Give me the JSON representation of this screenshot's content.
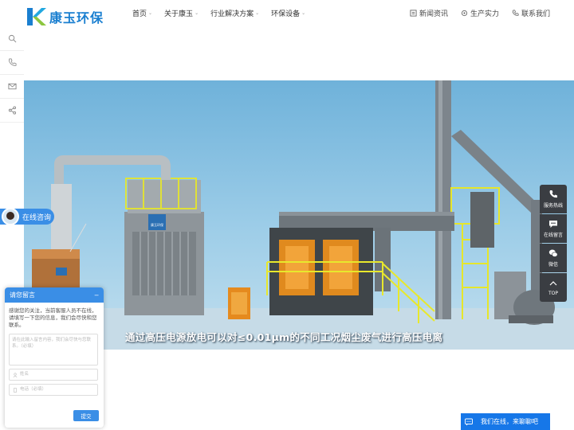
{
  "header": {
    "logo_text": "康玉环保",
    "nav": [
      {
        "label": "首页",
        "has_dropdown": true
      },
      {
        "label": "关于康玉",
        "has_dropdown": true
      },
      {
        "label": "行业解决方案",
        "has_dropdown": true
      },
      {
        "label": "环保设备",
        "has_dropdown": true
      }
    ],
    "right_links": [
      {
        "label": "新闻资讯",
        "icon": "news-icon"
      },
      {
        "label": "生产实力",
        "icon": "factory-icon"
      },
      {
        "label": "联系我们",
        "icon": "phone-icon"
      }
    ]
  },
  "left_bar": {
    "icons": [
      "search-icon",
      "phone-icon",
      "mail-icon",
      "share-icon"
    ]
  },
  "hero": {
    "caption": "通过高压电源放电可以对≤0.01μm的不同工况烟尘废气进行高压电离",
    "equipment_label": "康玉环保"
  },
  "consult": {
    "label": "在线咨询"
  },
  "message_panel": {
    "title": "请您留言",
    "intro": "感谢您的关注，当前客服人员不在线，请填写一下您的信息，我们会尽快和您联系。",
    "textarea_placeholder": "请在此输入留言内容，我们会尽快与您联系。（必填）",
    "name_placeholder": "姓名",
    "phone_placeholder": "电话（必填）",
    "submit_label": "提交"
  },
  "right_bar": {
    "items": [
      {
        "label": "服务热线",
        "icon": "phone-icon"
      },
      {
        "label": "在线留言",
        "icon": "message-icon"
      },
      {
        "label": "微信",
        "icon": "wechat-icon"
      },
      {
        "label": "TOP",
        "icon": "arrow-up-icon"
      }
    ]
  },
  "chat_bar": {
    "label": "我们在线，来聊聊吧"
  },
  "colors": {
    "brand_blue": "#1a7fd0",
    "accent_blue": "#3a8ee6",
    "dark_bar": "#3a3d42"
  }
}
